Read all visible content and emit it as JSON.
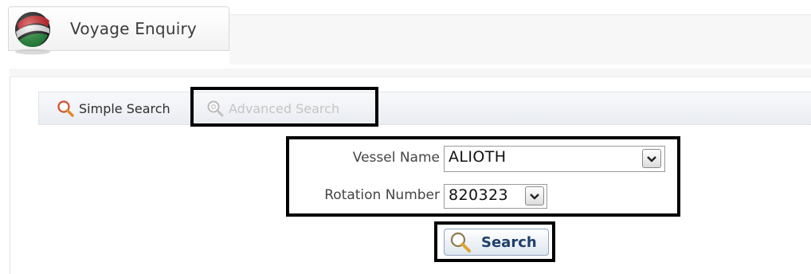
{
  "header": {
    "title": "Voyage Enquiry",
    "logo_icon": "globe-logo-icon"
  },
  "toolbar": {
    "simple_search_label": "Simple Search",
    "simple_search_icon": "magnifier-icon",
    "advanced_search_label": "Advanced Search",
    "advanced_search_icon": "magnifier-icon",
    "advanced_search_enabled": false
  },
  "form": {
    "vessel_name": {
      "label": "Vessel Name",
      "value": "ALIOTH"
    },
    "rotation_number": {
      "label": "Rotation Number",
      "value": "820323"
    }
  },
  "actions": {
    "search_label": "Search",
    "search_icon": "magnifier-icon"
  },
  "colors": {
    "highlight_frame": "#000000",
    "search_text": "#1f3f6c",
    "disabled_text": "#c5c5c5"
  }
}
